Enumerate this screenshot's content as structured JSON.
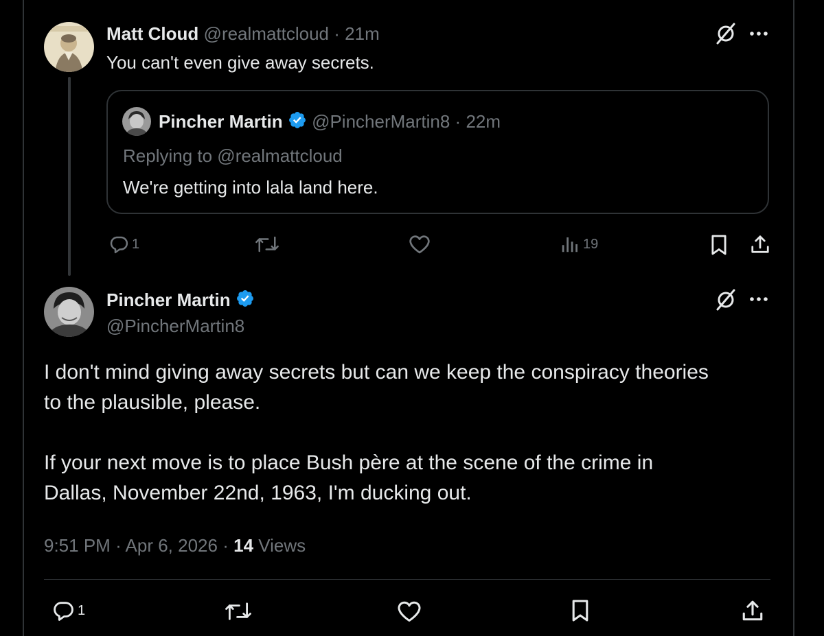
{
  "tweet1": {
    "name": "Matt Cloud",
    "handle": "@realmattcloud",
    "sep": "·",
    "time": "21m",
    "text": "You can't even give away secrets.",
    "quote": {
      "name": "Pincher Martin",
      "handle": "@PincherMartin8",
      "sep": "·",
      "time": "22m",
      "replying": "Replying to @realmattcloud",
      "text": "We're getting into lala land here."
    },
    "actions": {
      "replies": "1",
      "views": "19"
    }
  },
  "tweet2": {
    "name": "Pincher Martin",
    "handle": "@PincherMartin8",
    "para1_line1": "I don't mind giving away secrets but can we keep the conspiracy theories",
    "para1_line2": "to the plausible, please.",
    "para2_line1": "If your next move is to place Bush père at the scene of the crime in",
    "para2_line2": "Dallas, November 22nd, 1963, I'm ducking out.",
    "meta_time": "9:51 PM",
    "meta_sep1": "·",
    "meta_date": "Apr 6, 2026",
    "meta_sep2": "·",
    "meta_views_count": "14",
    "meta_views_label": "Views",
    "actions": {
      "replies": "1"
    }
  },
  "icons": [
    "grok-icon",
    "more-icon",
    "reply-icon",
    "retweet-icon",
    "like-icon",
    "views-icon",
    "bookmark-icon",
    "share-icon",
    "verified-badge-icon"
  ],
  "colors": {
    "background": "#000000",
    "text": "#e7e9ea",
    "muted": "#71767b",
    "border": "#2f3336",
    "verified": "#1d9bf0"
  }
}
